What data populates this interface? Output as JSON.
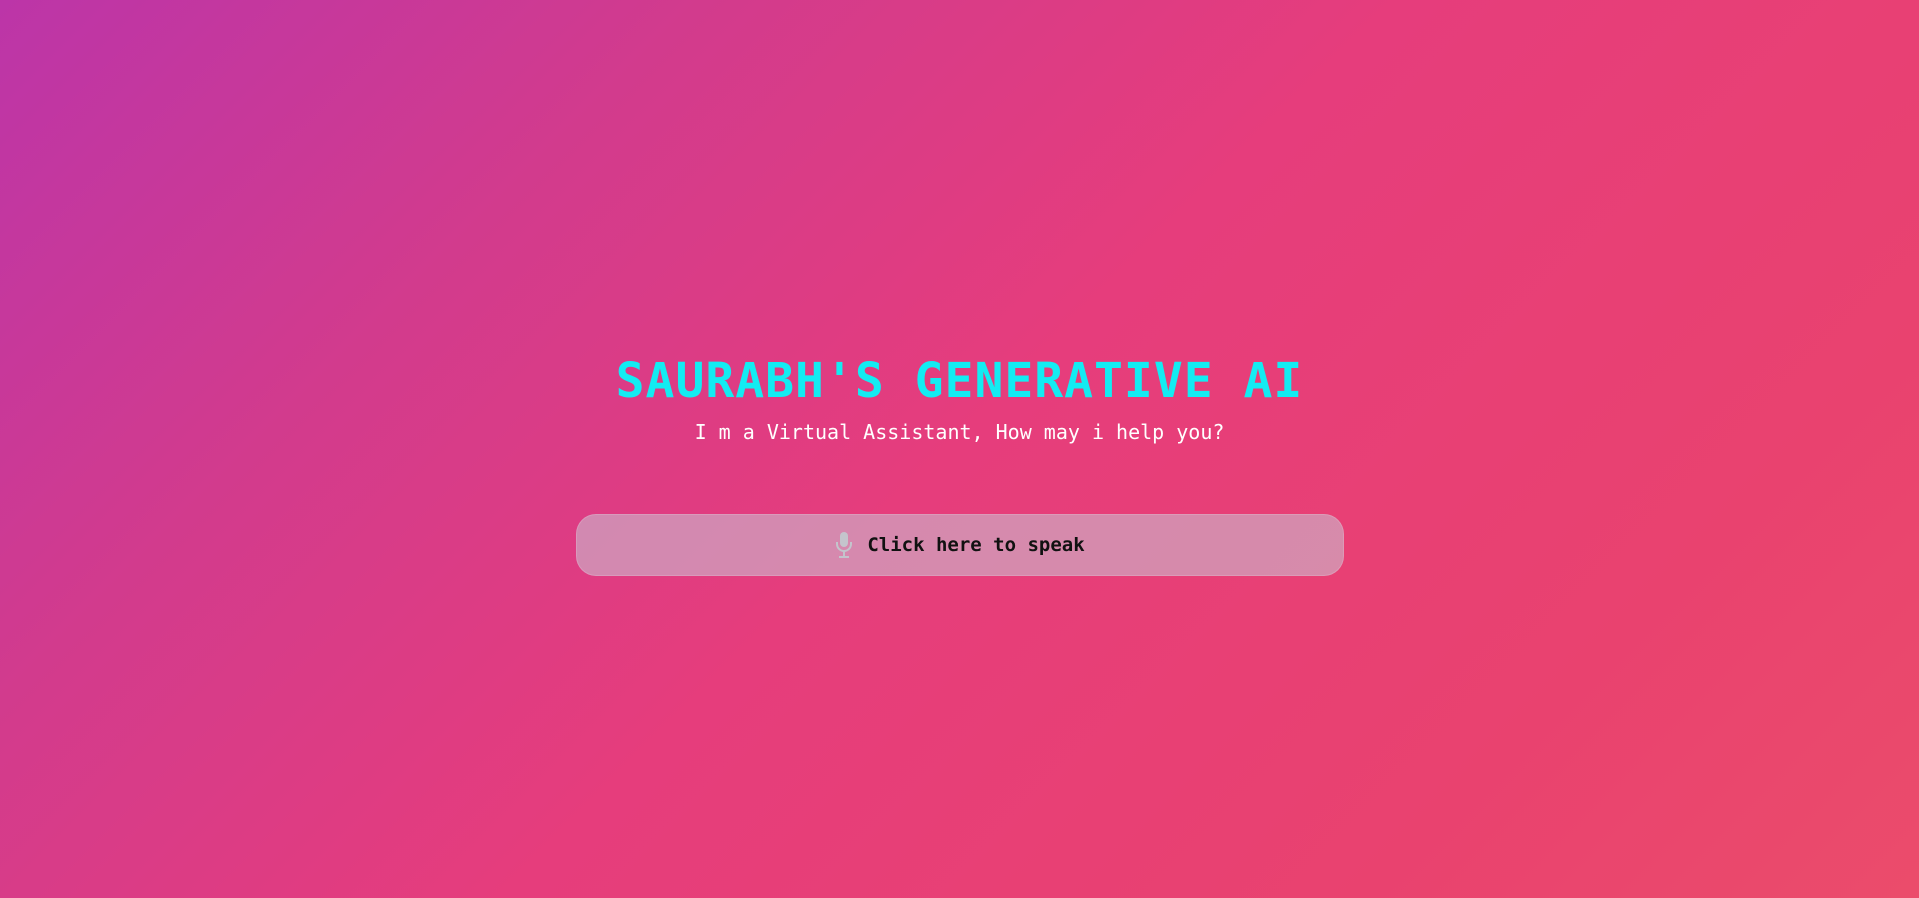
{
  "hero": {
    "title": "SAURABH'S GENERATIVE AI",
    "subtitle": "I m a Virtual Assistant, How may i help you?"
  },
  "speak_button": {
    "icon": "microphone-icon",
    "label": "Click here to speak"
  },
  "colors": {
    "title": "#13ecf2",
    "subtitle": "#ffffff",
    "background_start": "#bc35a8",
    "background_end": "#eb4c6b",
    "button_background": "#d7a1c4"
  }
}
